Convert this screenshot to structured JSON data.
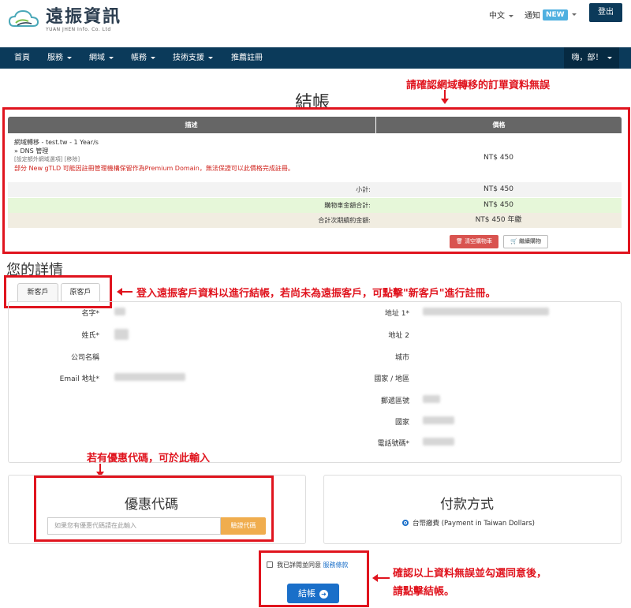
{
  "header": {
    "logo_text": "遠振資訊",
    "logo_sub": "YUAN JHEN Info. Co. Ltd",
    "lang": "中文",
    "notify": "通知",
    "new_badge": "NEW",
    "logout": "登出"
  },
  "nav": {
    "items": [
      "首頁",
      "服務",
      "網域",
      "帳務",
      "技術支援",
      "推薦註冊"
    ],
    "user": "嗨，部！"
  },
  "title": "結帳",
  "annotations": {
    "confirm_order": "請確認網域轉移的訂單資料無誤",
    "login_hint": "登入遠振客戶資料以進行結帳，若尚未為遠振客戶，可點擊\"新客戶\"進行註冊。",
    "coupon_hint": "若有優惠代碼，可於此輸入",
    "checkout_hint_1": "確認以上資料無誤並勾選同意後，",
    "checkout_hint_2": "請點擊結帳。"
  },
  "table": {
    "col_desc": "描述",
    "col_price": "價格",
    "item_line1": "網域轉移 - test.tw - 1 Year/s",
    "item_line2": "» DNS 管理",
    "item_links": "[設定額外網域選項] [移除]",
    "item_note": "部分 New gTLD 可能因註冊管理機構保留作為Premium Domain，無法保證可以此價格完成註冊。",
    "item_price": "NT$ 450",
    "subtotal_label": "小計:",
    "subtotal_value": "NT$ 450",
    "total_label": "購物車金額合計:",
    "total_value": "NT$ 450",
    "recurring_label": "合計次期續約金額:",
    "recurring_value": "NT$ 450 年繳",
    "empty_cart": "清空購物車",
    "continue_shopping": "繼續購物"
  },
  "details": {
    "title": "您的詳情",
    "tab_new": "新客戶",
    "tab_existing": "原客戶",
    "left_labels": [
      "名字*",
      "姓氏*",
      "公司名稱",
      "Email 地址*"
    ],
    "right_labels": [
      "地址 1*",
      "地址 2",
      "城市",
      "國家 / 地區",
      "郵遞區號",
      "國家",
      "電話號碼*"
    ]
  },
  "coupon": {
    "title": "優惠代碼",
    "placeholder": "如果您有優惠代碼請在此輸入",
    "button": "驗證代碼"
  },
  "payment": {
    "title": "付款方式",
    "option": "台幣繳費 (Payment in Taiwan Dollars)"
  },
  "agree": {
    "text": "我已詳閱並同意",
    "tos": "服務條款"
  },
  "checkout_button": "結帳",
  "colors": {
    "nav_bg": "#0b3a5a",
    "annotation_red": "#e0141e",
    "primary_blue": "#1a6fc9",
    "coupon_orange": "#f0ad4e",
    "danger": "#d9534f",
    "total_green": "#e6f7d9",
    "recurring_beige": "#f1ede1"
  }
}
